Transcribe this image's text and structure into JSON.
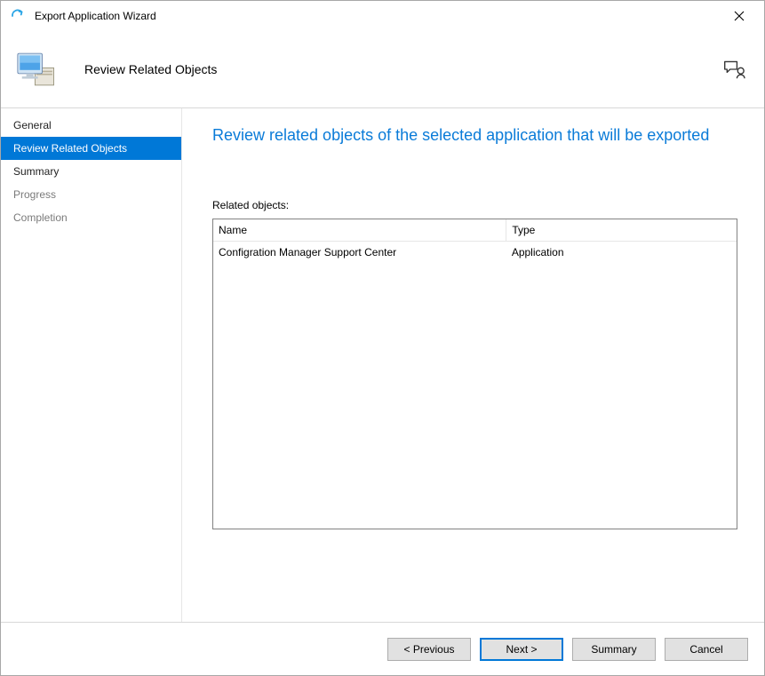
{
  "window": {
    "title": "Export Application Wizard"
  },
  "header": {
    "subtitle": "Review Related Objects"
  },
  "sidebar": {
    "steps": [
      {
        "label": "General",
        "state": "done"
      },
      {
        "label": "Review Related Objects",
        "state": "active"
      },
      {
        "label": "Summary",
        "state": "pending"
      },
      {
        "label": "Progress",
        "state": "disabled"
      },
      {
        "label": "Completion",
        "state": "disabled"
      }
    ]
  },
  "content": {
    "heading": "Review related objects of the selected application that will be exported",
    "list_label": "Related objects:",
    "columns": {
      "name": "Name",
      "type": "Type"
    },
    "rows": [
      {
        "name": "Configration Manager Support Center",
        "type": "Application"
      }
    ]
  },
  "footer": {
    "previous": "< Previous",
    "next": "Next >",
    "summary": "Summary",
    "cancel": "Cancel"
  }
}
